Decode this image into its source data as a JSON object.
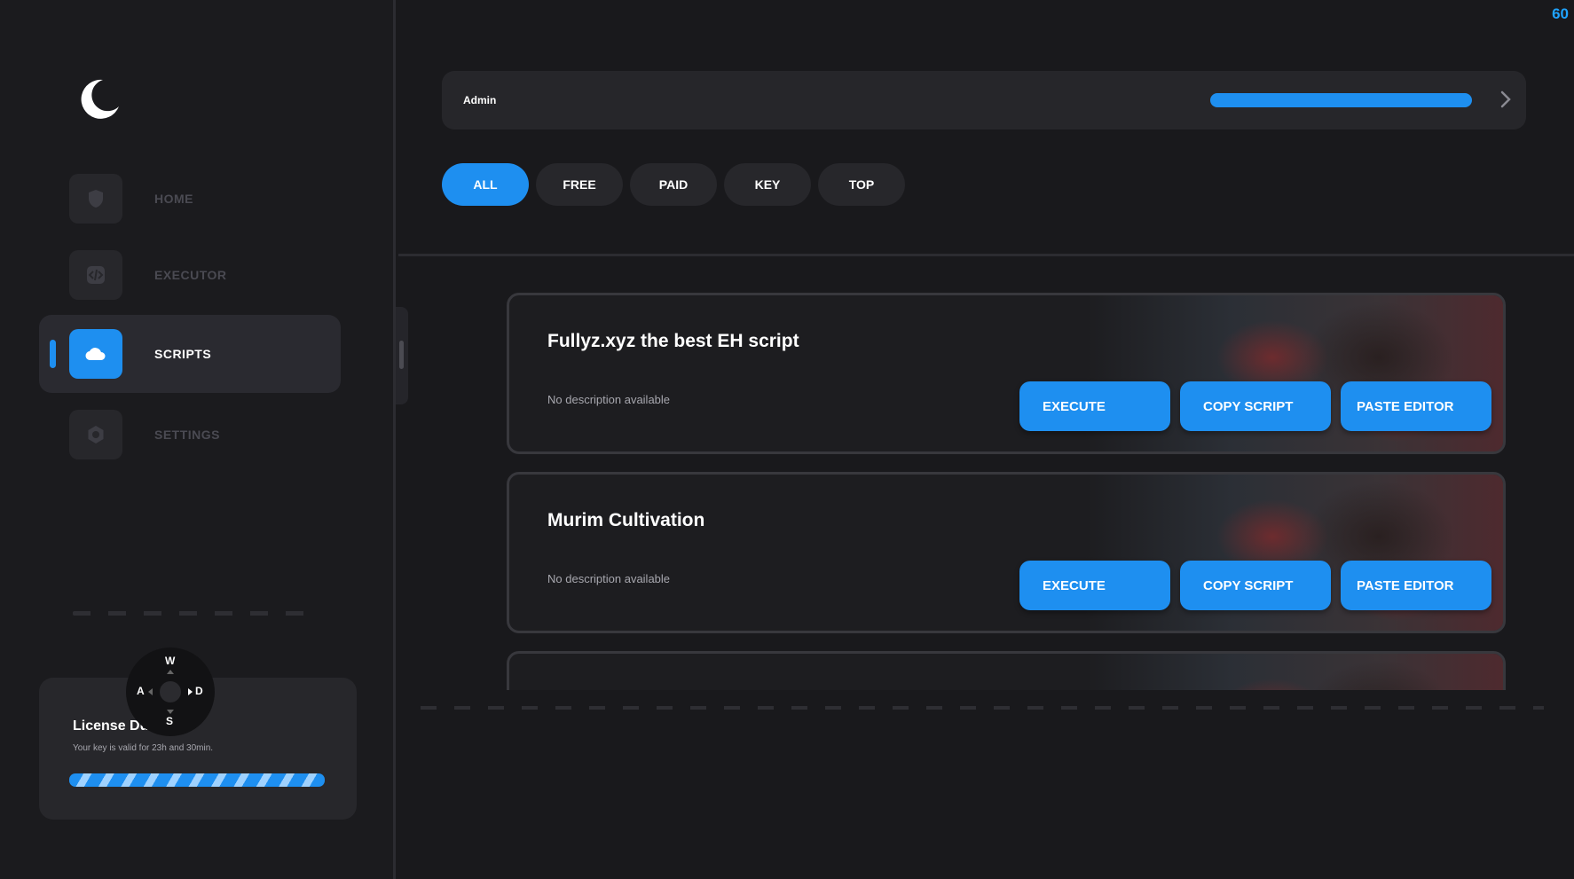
{
  "fps": "60",
  "sidebar": {
    "items": [
      {
        "label": "HOME",
        "icon": "shield-icon"
      },
      {
        "label": "EXECUTOR",
        "icon": "code-icon"
      },
      {
        "label": "SCRIPTS",
        "icon": "cloud-icon"
      },
      {
        "label": "SETTINGS",
        "icon": "gear-icon"
      }
    ],
    "active": "SCRIPTS"
  },
  "license": {
    "title": "License Duration",
    "description": "Your key is valid for 23h and 30min."
  },
  "wasd": {
    "w": "W",
    "a": "A",
    "s": "S",
    "d": "D"
  },
  "header": {
    "label": "Admin",
    "progress": 1.0
  },
  "tabs": [
    {
      "label": "ALL",
      "active": true
    },
    {
      "label": "FREE"
    },
    {
      "label": "PAID"
    },
    {
      "label": "KEY"
    },
    {
      "label": "TOP"
    }
  ],
  "scripts": [
    {
      "title": "Fullyz.xyz the best EH script",
      "description": "No description available",
      "execute": "EXECUTE",
      "copy": "COPY SCRIPT",
      "paste": "PASTE EDITOR"
    },
    {
      "title": "Murim Cultivation",
      "description": "No description available",
      "execute": "EXECUTE",
      "copy": "COPY SCRIPT",
      "paste": "PASTE EDITOR"
    }
  ],
  "colors": {
    "accent": "#1e8ff0",
    "background": "#19191c",
    "panel": "#27272b",
    "fps": "#1fa3ff"
  }
}
